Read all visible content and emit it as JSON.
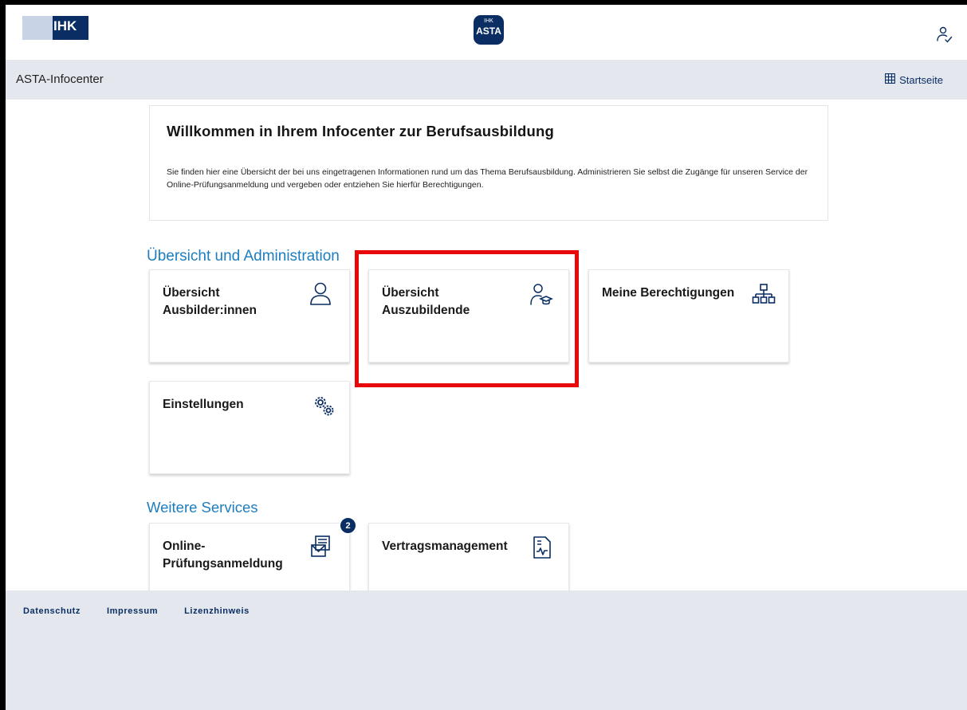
{
  "header": {
    "ihk_logo_text": "IHK",
    "asta_logo_small": "IHK",
    "asta_logo_big": "ASTA",
    "user_icon": "user-check-icon"
  },
  "subbar": {
    "title": "ASTA-Infocenter",
    "startseite_label": "Startseite",
    "startseite_icon": "grid-icon"
  },
  "welcome": {
    "title": "Willkommen in Ihrem Infocenter zur Berufsausbildung",
    "text": "Sie finden hier eine Übersicht der bei uns eingetragenen Informationen rund um das Thema Berufsausbildung. Administrieren Sie selbst die Zugänge für unseren Service der Online-Prüfungsanmeldung und vergeben oder entziehen Sie hierfür Berechtigungen."
  },
  "sections": {
    "admin_title": "Übersicht und Administration",
    "services_title": "Weitere Services"
  },
  "tiles": {
    "ausbilder": {
      "label_line1": "Übersicht",
      "label_line2": "Ausbilder:innen",
      "icon": "user-icon"
    },
    "auszubildende": {
      "label_line1": "Übersicht",
      "label_line2": "Auszubildende",
      "icon": "student-icon"
    },
    "berechtigungen": {
      "label": "Meine Berechtigungen",
      "icon": "hierarchy-icon"
    },
    "einstellungen": {
      "label": "Einstellungen",
      "icon": "gears-icon"
    },
    "pruefung": {
      "label_line1": "Online-",
      "label_line2": "Prüfungsanmeldung",
      "icon": "mail-form-icon",
      "badge": "2"
    },
    "vertrag": {
      "label": "Vertragsmanagement",
      "icon": "contract-icon"
    }
  },
  "footer": {
    "links": [
      "Datenschutz",
      "Impressum",
      "Lizenzhinweis"
    ]
  },
  "colors": {
    "brand_dark": "#0a2e63",
    "section_title": "#1d7dbf",
    "bar_background": "#e4e8ee",
    "highlight": "#e8080c"
  }
}
